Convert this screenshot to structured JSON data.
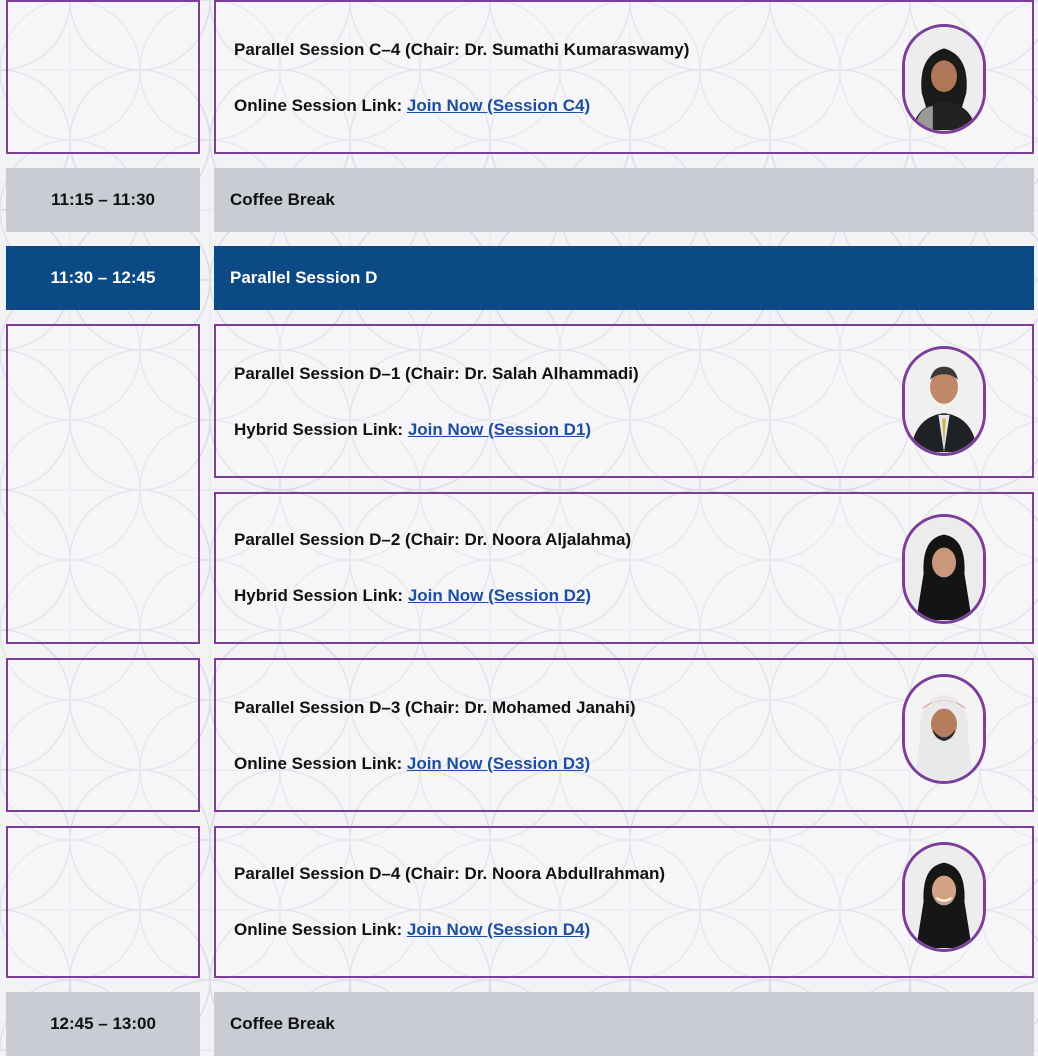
{
  "rows": {
    "coffee_break_1": {
      "time": "11:15 – 11:30",
      "label": "Coffee Break"
    },
    "parallel_d": {
      "time": "11:30 – 12:45",
      "label": "Parallel Session D"
    },
    "coffee_break_2": {
      "time": "12:45 – 13:00",
      "label": "Coffee Break"
    }
  },
  "sessions": [
    {
      "title": "Parallel Session C–4 (Chair: Dr. Sumathi Kumaraswamy)",
      "link_prefix": "Online Session Link:",
      "link_text": "Join Now (Session C4)",
      "avatar": "chair-photo-female-dark-hair"
    },
    {
      "title": "Parallel Session D–1 (Chair: Dr. Salah Alhammadi)",
      "link_prefix": "Hybrid Session Link:",
      "link_text": "Join Now (Session D1)",
      "avatar": "chair-photo-male-suit"
    },
    {
      "title": "Parallel Session D–2 (Chair: Dr. Noora Aljalahma)",
      "link_prefix": "Hybrid Session Link:",
      "link_text": "Join Now (Session D2)",
      "avatar": "chair-photo-female-hijab"
    },
    {
      "title": "Parallel Session D–3 (Chair: Dr. Mohamed Janahi)",
      "link_prefix": "Online Session Link:",
      "link_text": "Join Now (Session D3)",
      "avatar": "chair-photo-male-ghutra"
    },
    {
      "title": "Parallel Session D–4 (Chair: Dr. Noora Abdullrahman)",
      "link_prefix": "Online Session Link:",
      "link_text": "Join Now (Session D4)",
      "avatar": "chair-photo-female-hijab"
    }
  ],
  "colors": {
    "purple_border": "#7b3f98",
    "header_blue": "#0c4a85",
    "break_grey": "#c9cdd3",
    "link_blue": "#1d4fa0"
  }
}
